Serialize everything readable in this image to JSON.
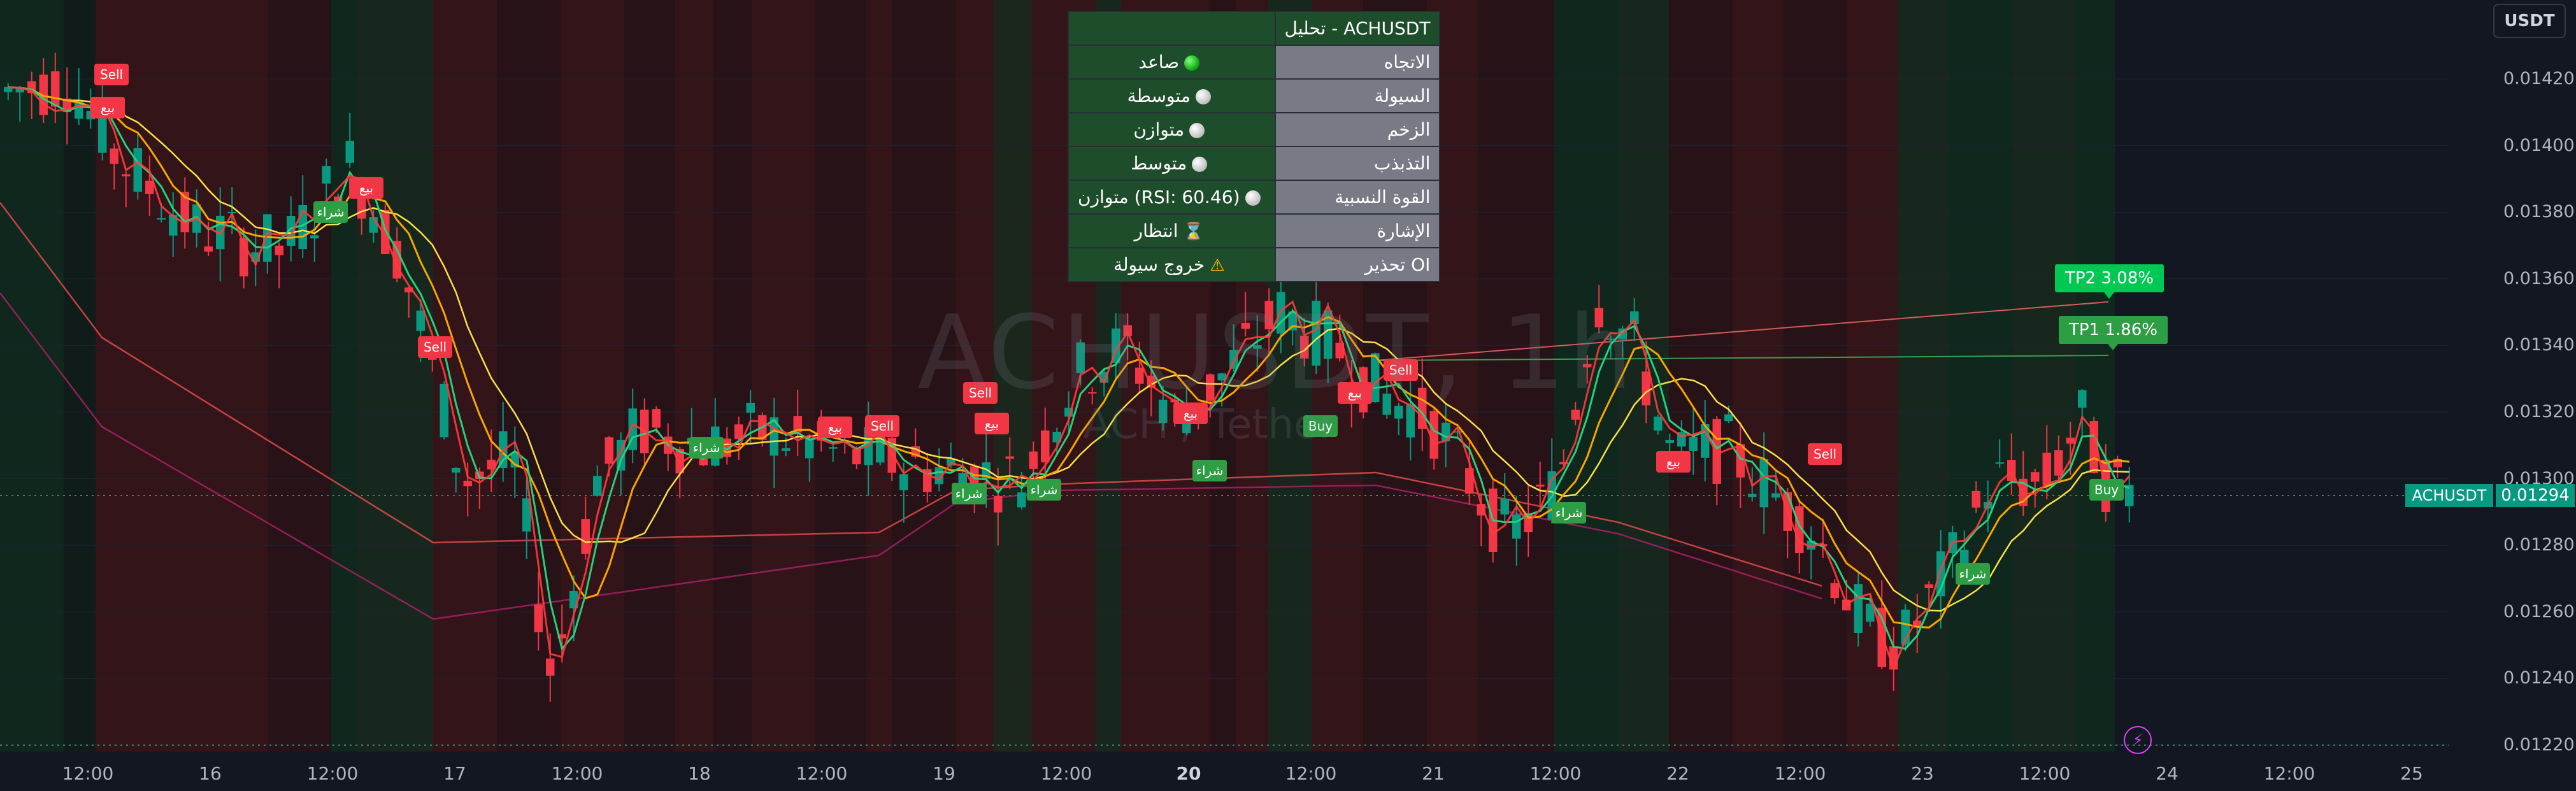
{
  "chart": {
    "symbol_watermark": "ACHUSDT, 1h",
    "pair_watermark": "ACH / Tether",
    "symbol_tag": "ACHUSDT",
    "last_price": "0.01294",
    "currency": "USDT",
    "colors": {
      "up": "#089981",
      "down": "#f23645",
      "fast_ma": "#26d07c",
      "mid_ma": "#f7a600",
      "slow_ma": "#fbe04a",
      "trend": "#ff5252",
      "bg": "#131722"
    }
  },
  "price_axis": {
    "ticks": [
      "0.01420",
      "0.01400",
      "0.01380",
      "0.01360",
      "0.01340",
      "0.01320",
      "0.01300",
      "0.01280",
      "0.01260",
      "0.01240",
      "0.01220"
    ]
  },
  "time_axis": {
    "ticks": [
      {
        "label": "12:00",
        "bold": false
      },
      {
        "label": "16",
        "bold": false
      },
      {
        "label": "12:00",
        "bold": false
      },
      {
        "label": "17",
        "bold": false
      },
      {
        "label": "12:00",
        "bold": false
      },
      {
        "label": "18",
        "bold": false
      },
      {
        "label": "12:00",
        "bold": false
      },
      {
        "label": "19",
        "bold": false
      },
      {
        "label": "12:00",
        "bold": false
      },
      {
        "label": "20",
        "bold": true
      },
      {
        "label": "12:00",
        "bold": false
      },
      {
        "label": "21",
        "bold": false
      },
      {
        "label": "12:00",
        "bold": false
      },
      {
        "label": "22",
        "bold": false
      },
      {
        "label": "12:00",
        "bold": false
      },
      {
        "label": "23",
        "bold": false
      },
      {
        "label": "12:00",
        "bold": false
      },
      {
        "label": "24",
        "bold": false
      },
      {
        "label": "12:00",
        "bold": false
      },
      {
        "label": "25",
        "bold": false
      }
    ]
  },
  "analysis_table": {
    "title": "تحليل - ACHUSDT",
    "rows": [
      {
        "key": "الاتجاه",
        "value": "صاعد",
        "icon": "green-dot"
      },
      {
        "key": "السيولة",
        "value": "متوسطة",
        "icon": "white-dot"
      },
      {
        "key": "الزخم",
        "value": "متوازن",
        "icon": "white-dot"
      },
      {
        "key": "التذبذب",
        "value": "متوسط",
        "icon": "white-dot"
      },
      {
        "key": "القوة النسبية",
        "value": "متوازن (RSI: 60.46)",
        "icon": "white-dot"
      },
      {
        "key": "الإشارة",
        "value": "انتظار",
        "icon": "hourglass-icon"
      },
      {
        "key": "تحذير OI",
        "value": "خروج سيولة",
        "icon": "warning-icon"
      }
    ]
  },
  "targets": {
    "tp2": "TP2 3.08%",
    "tp1": "TP1 1.86%"
  },
  "signals": {
    "buy_en": "Buy",
    "sell_en": "Sell",
    "buy_ar": "شراء",
    "sell_ar": "بيع"
  },
  "chart_data": {
    "type": "candlestick",
    "ylim": [
      0.01214,
      0.01428
    ],
    "x_range_hours": [
      0,
      240
    ],
    "candles": [],
    "tp_levels": [
      0.013346,
      0.01336
    ]
  }
}
